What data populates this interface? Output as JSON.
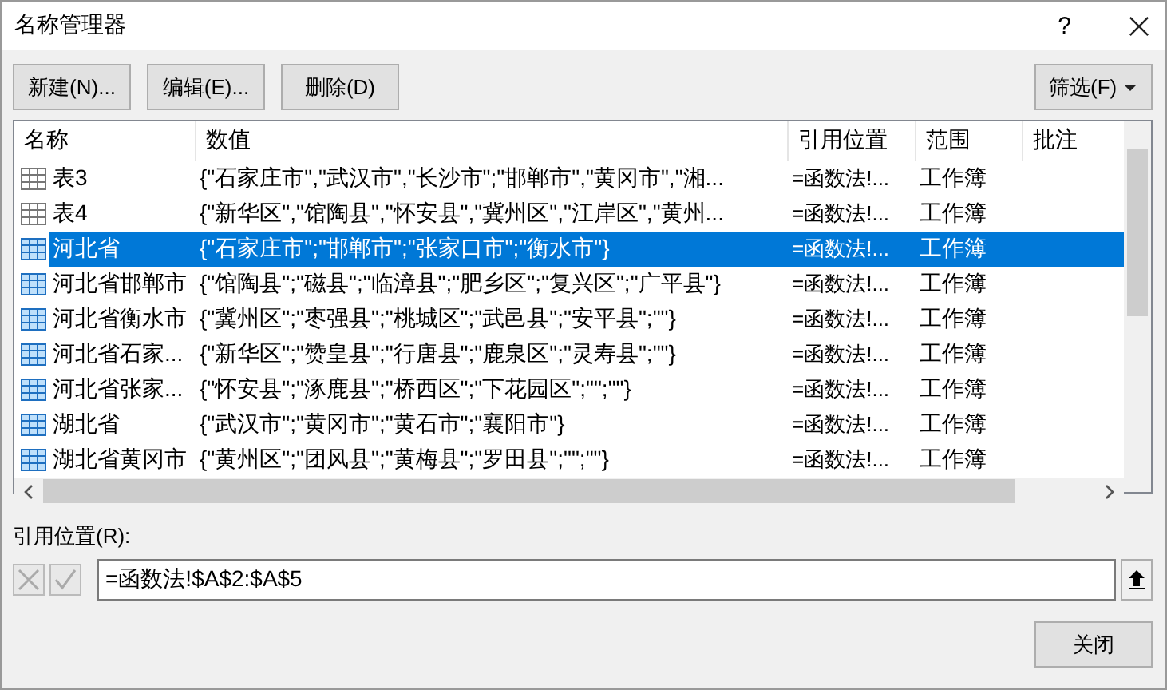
{
  "window": {
    "title": "名称管理器",
    "help": "?"
  },
  "toolbar": {
    "buttons": [
      "新建(N)...",
      "编辑(E)...",
      "删除(D)"
    ],
    "filter": "筛选(F)"
  },
  "table": {
    "columns": [
      "名称",
      "数值",
      "引用位置",
      "范围",
      "批注"
    ],
    "rows": [
      {
        "kind": "table",
        "name": "表3",
        "value": "{\"石家庄市\",\"武汉市\",\"长沙市\";\"邯郸市\",\"黄冈市\",\"湘...",
        "ref": "=函数法!...",
        "scope": "工作簿",
        "selected": false
      },
      {
        "kind": "table",
        "name": "表4",
        "value": "{\"新华区\",\"馆陶县\",\"怀安县\",\"冀州区\",\"江岸区\",\"黄州...",
        "ref": "=函数法!...",
        "scope": "工作簿",
        "selected": false
      },
      {
        "kind": "range",
        "name": "河北省",
        "value": "{\"石家庄市\";\"邯郸市\";\"张家口市\";\"衡水市\"}",
        "ref": "=函数法!...",
        "scope": "工作簿",
        "selected": true
      },
      {
        "kind": "range",
        "name": "河北省邯郸市",
        "value": "{\"馆陶县\";\"磁县\";\"临漳县\";\"肥乡区\";\"复兴区\";\"广平县\"}",
        "ref": "=函数法!...",
        "scope": "工作簿",
        "selected": false
      },
      {
        "kind": "range",
        "name": "河北省衡水市",
        "value": "{\"冀州区\";\"枣强县\";\"桃城区\";\"武邑县\";\"安平县\";\"\"}",
        "ref": "=函数法!...",
        "scope": "工作簿",
        "selected": false
      },
      {
        "kind": "range",
        "name": "河北省石家...",
        "value": "{\"新华区\";\"赞皇县\";\"行唐县\";\"鹿泉区\";\"灵寿县\";\"\"}",
        "ref": "=函数法!...",
        "scope": "工作簿",
        "selected": false
      },
      {
        "kind": "range",
        "name": "河北省张家...",
        "value": "{\"怀安县\";\"涿鹿县\";\"桥西区\";\"下花园区\";\"\";\"\"}",
        "ref": "=函数法!...",
        "scope": "工作簿",
        "selected": false
      },
      {
        "kind": "range",
        "name": "湖北省",
        "value": "{\"武汉市\";\"黄冈市\";\"黄石市\";\"襄阳市\"}",
        "ref": "=函数法!...",
        "scope": "工作簿",
        "selected": false
      },
      {
        "kind": "range",
        "name": "湖北省黄冈市",
        "value": "{\"黄州区\";\"团风县\";\"黄梅县\";\"罗田县\";\"\";\"\"}",
        "ref": "=函数法!...",
        "scope": "工作簿",
        "selected": false
      }
    ]
  },
  "reference": {
    "label": "引用位置(R):",
    "value": "=函数法!$A$2:$A$5"
  },
  "close_button": "关闭"
}
